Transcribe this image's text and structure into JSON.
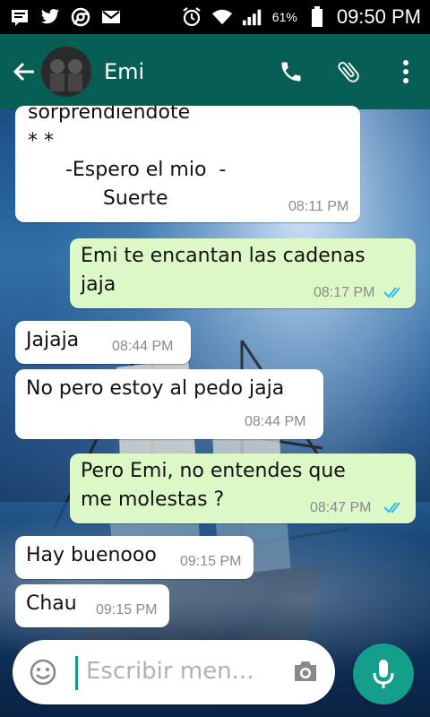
{
  "status_bar": {
    "battery_percent": "61%",
    "time": "09:50 PM",
    "icons": [
      "notification-icon",
      "twitter-icon",
      "chrome-icon",
      "gmail-icon",
      "alarm-icon",
      "wifi-icon",
      "signal-icon",
      "battery-icon"
    ]
  },
  "header": {
    "contact_name": "Emi",
    "icons": [
      "back-arrow-icon",
      "phone-icon",
      "attach-icon",
      "overflow-menu-icon"
    ]
  },
  "messages": [
    {
      "direction": "in",
      "text": "sorprendiendote\n* *\n      -Espero el mio  -\n            Suerte",
      "time": "08:11 PM"
    },
    {
      "direction": "out",
      "text": "Emi te encantan las cadenas\njaja",
      "time": "08:17 PM",
      "read": true
    },
    {
      "direction": "in",
      "text": "Jajaja",
      "time": "08:44 PM"
    },
    {
      "direction": "in",
      "text": "No pero estoy al pedo jaja",
      "time": "08:44 PM"
    },
    {
      "direction": "out",
      "text": "Pero Emi, no entendes que\nme molestas ?",
      "time": "08:47 PM",
      "read": true
    },
    {
      "direction": "in",
      "text": "Hay buenooo",
      "time": "09:15 PM"
    },
    {
      "direction": "in",
      "text": "Chau",
      "time": "09:15 PM"
    }
  ],
  "composer": {
    "placeholder": "Escribir men...",
    "icons": [
      "emoji-icon",
      "camera-icon",
      "mic-icon"
    ],
    "accent": "#139f8a"
  },
  "colors": {
    "app_bar": "#075e54",
    "incoming_bubble": "#ffffff",
    "outgoing_bubble": "#dcf8c6",
    "read_ticks": "#34b7f1"
  }
}
